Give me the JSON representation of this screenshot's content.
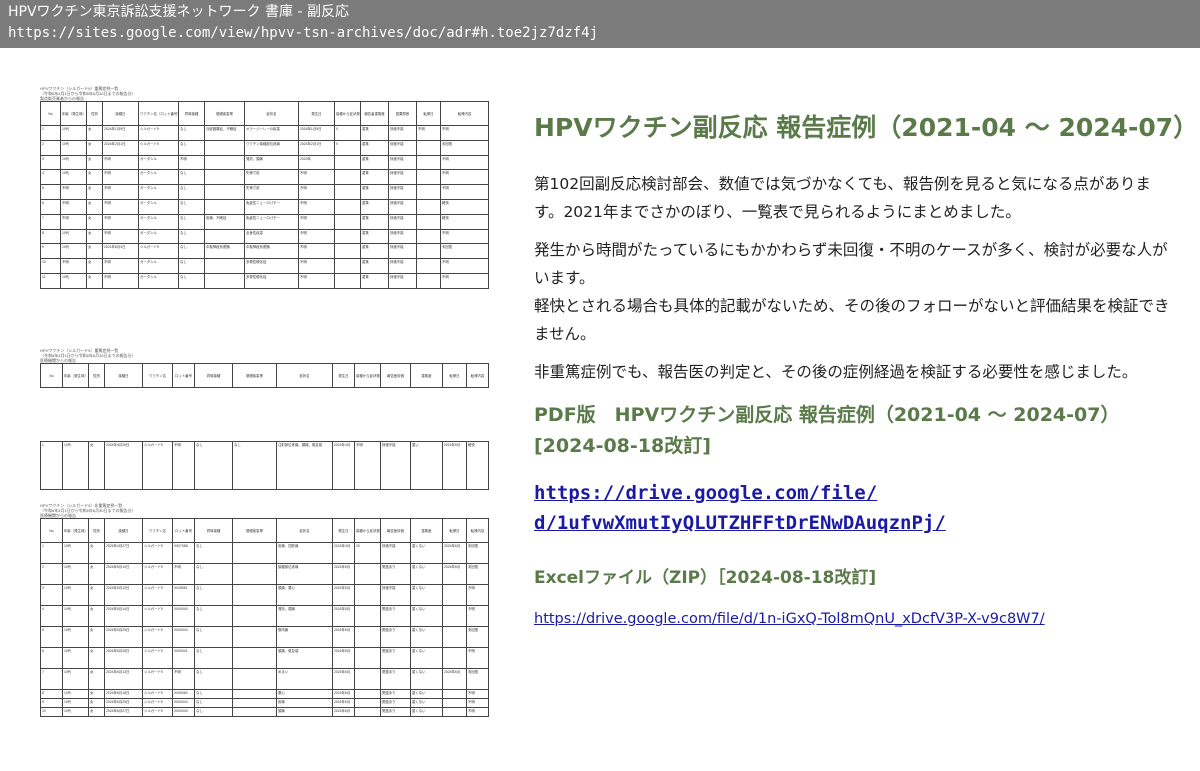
{
  "window": {
    "title": "HPVワクチン東京訴訟支援ネットワーク 書庫 - 副反応",
    "url": "https://sites.google.com/view/hpvv-tsn-archives/doc/adr#h.toe2jz7dzf4j"
  },
  "main": {
    "heading": "HPVワクチン副反応 報告症例（2021-04 〜 2024-07）",
    "paragraphs": [
      "第102回副反応検討部会、数値では気づかなくても、報告例を見ると気になる点があります。2021年までさかのぼり、一覧表で見られるようにまとめました。",
      "発生から時間がたっているにもかかわらず未回復・不明のケースが多く、検討が必要な人がいます。",
      "軽快とされる場合も具体的記載がないため、その後のフォローがないと評価結果を検証できません。",
      "非重篤症例でも、報告医の判定と、その後の症例経過を検証する必要性を感じました。"
    ],
    "pdf_title": "PDF版　HPVワクチン副反応 報告症例（2021-04 〜 2024-07）",
    "pdf_revision": "[2024-08-18改訂]",
    "pdf_link_line1": "https://drive.google.com/file/",
    "pdf_link_line2": "d/1ufvwXmutIyQLUTZHFFtDrENwDAuqznPj/",
    "excel_title": "Excelファイル（ZIP）［2024-08-18改訂]",
    "excel_link": "https://drive.google.com/file/d/1n-iGxQ-Tol8mQnU_xDcfV3P-X-v9c8W7/"
  },
  "scan": {
    "page1": {
      "caption1": "HPVワクチン（シルガード9）重篤症例一覧",
      "caption2": "（令和6年4月1日から令和6年6月30日までの報告分）",
      "caption3": "製造販売業者からの報告",
      "headers": [
        "No",
        "年齢（発生時）",
        "性別",
        "接種日",
        "ワクチン名（ロット番号）",
        "同時接種",
        "基礎疾患等",
        "症状名",
        "発生日",
        "接種から症状発生までの日数",
        "報告者重篤度",
        "因果関係",
        "転帰日",
        "転帰内容"
      ],
      "rows": [
        [
          "1",
          "10代",
          "女",
          "2024年1月9日",
          "シルガード9",
          "なし",
          "月経困難症、不眠症",
          "オラージーレーの疾患",
          "2024年1月9日",
          "0",
          "重篤",
          "評価不能",
          "不明",
          "不明"
        ],
        [
          "2",
          "10代",
          "女",
          "2024年2月1日",
          "シルガード9",
          "なし",
          "",
          "ワクチン接種部位疼痛",
          "2024年2月1日",
          "0",
          "重篤",
          "評価不能",
          "",
          "未回復"
        ],
        [
          "3",
          "10代",
          "女",
          "不明",
          "ガーダシル",
          "不明",
          "",
          "発熱、頭痛",
          "2023年",
          "",
          "重篤",
          "評価不能",
          "",
          "不明"
        ],
        [
          "4",
          "10代",
          "女",
          "不明",
          "ガーダシル",
          "なし",
          "",
          "失神寸前",
          "不明",
          "",
          "重篤",
          "評価不能",
          "",
          "不明"
        ],
        [
          "5",
          "不明",
          "女",
          "不明",
          "ガーダシル",
          "なし",
          "",
          "失神寸前",
          "不明",
          "",
          "重篤",
          "評価不能",
          "",
          "不明"
        ],
        [
          "6",
          "不明",
          "女",
          "不明",
          "ガーダシル",
          "なし",
          "",
          "免疫性ニューロパチー",
          "不明",
          "",
          "重篤",
          "評価不能",
          "",
          "軽快"
        ],
        [
          "7",
          "不明",
          "女",
          "不明",
          "ガーダシル",
          "なし",
          "疼痛、不眠症",
          "免疫性ニューロパチー",
          "不明",
          "",
          "重篤",
          "評価不能",
          "",
          "軽快"
        ],
        [
          "8",
          "10代",
          "女",
          "不明",
          "ガーダシル",
          "なし",
          "",
          "全身性疾患",
          "不明",
          "",
          "重篤",
          "評価不能",
          "",
          "不明"
        ],
        [
          "9",
          "10代",
          "女",
          "2021年8月3日",
          "シルガード9",
          "なし",
          "中枢神経系脱髄",
          "中枢神経系脱髄",
          "不明",
          "",
          "重篤",
          "評価不能",
          "",
          "未回復"
        ],
        [
          "10",
          "不明",
          "女",
          "不明",
          "ガーダシル",
          "なし",
          "",
          "多発性硬化症",
          "不明",
          "",
          "重篤",
          "評価不能",
          "",
          "不明"
        ],
        [
          "11",
          "10代",
          "女",
          "不明",
          "ガーダシル",
          "なし",
          "",
          "多発性硬化症",
          "不明",
          "",
          "重篤",
          "評価不能",
          "",
          "不明"
        ]
      ]
    },
    "page2": {
      "caption1": "HPVワクチン（シルガード9）重篤症例一覧",
      "caption2": "（令和6年4月1日から令和6年6月30日までの報告分）",
      "caption3": "医療機関からの報告",
      "headers": [
        "No",
        "年齢（発生時）",
        "性別",
        "接種日",
        "ワクチン名",
        "ロット番号",
        "同時接種",
        "基礎疾患等",
        "症状名",
        "発生日",
        "接種から症状発生までの日数",
        "報告医評価",
        "重篤度",
        "転帰日",
        "転帰内容"
      ],
      "row": [
        "1",
        "10代",
        "女",
        "2024年4月26日",
        "シルガード9",
        "不明",
        "なし",
        "なし",
        "注射部位疼痛、頭痛、倦怠感",
        "2024年4月",
        "不明",
        "評価不能",
        "重い",
        "2024年5月",
        "軽快"
      ]
    },
    "page3": {
      "caption1": "HPVワクチン（シルガード9）非重篤症例一覧",
      "caption2": "（令和6年4月1日から令和6年6月30日までの報告分）",
      "caption3": "医療機関からの報告",
      "headers": [
        "No",
        "年齢（発生時）",
        "性別",
        "接種日",
        "ワクチン名",
        "ロット番号",
        "同時接種",
        "基礎疾患等",
        "症状名",
        "発生日",
        "接種から症状発生までの日数",
        "報告医評価",
        "重篤度",
        "転帰日",
        "転帰内容"
      ],
      "rows": [
        [
          "1",
          "10代",
          "女",
          "2024年4月27日",
          "シルガード9",
          "X007088",
          "なし",
          "",
          "疼痛、四肢痛",
          "2024年4月",
          "20",
          "評価不能",
          "重くない",
          "2024年6月",
          "未回復"
        ],
        [
          "2",
          "10代",
          "女",
          "2024年5月10日",
          "シルガード9",
          "不明",
          "なし",
          "",
          "接種部位疼痛",
          "2024年5月",
          "",
          "関連あり",
          "重くない",
          "2024年5月",
          "未回復"
        ],
        [
          "3",
          "10代",
          "女",
          "2024年5月13日",
          "シルガード9",
          "X028981",
          "なし",
          "",
          "頭痛、悪心",
          "2024年5月",
          "",
          "評価不能",
          "重くない",
          "",
          "不明"
        ],
        [
          "4",
          "10代",
          "女",
          "2024年5月14日",
          "シルガード9",
          "X000040",
          "なし",
          "",
          "発熱、頭痛",
          "2024年5月",
          "",
          "関連あり",
          "重くない",
          "",
          "不明"
        ],
        [
          "5",
          "10代",
          "女",
          "2024年5月25日",
          "シルガード9",
          "X000040",
          "なし",
          "",
          "筋肉痛",
          "2024年5月",
          "",
          "関連あり",
          "重くない",
          "",
          "未回復"
        ],
        [
          "6",
          "10代",
          "女",
          "2024年5月28日",
          "シルガード9",
          "X000041",
          "なし",
          "",
          "頭痛、倦怠感",
          "2024年5月",
          "",
          "関連あり",
          "重くない",
          "",
          "不明"
        ],
        [
          "7",
          "10代",
          "女",
          "2024年6月13日",
          "シルガード9",
          "不明",
          "なし",
          "",
          "めまい",
          "2024年6月",
          "",
          "関連あり",
          "重くない",
          "2024年6月",
          "未回復"
        ],
        [
          "8",
          "10代",
          "女",
          "2024年6月18日",
          "シルガード9",
          "X006060",
          "なし",
          "",
          "悪心",
          "2024年6月",
          "",
          "関連あり",
          "重くない",
          "",
          "不明"
        ],
        [
          "9",
          "10代",
          "女",
          "2024年6月25日",
          "シルガード9",
          "X000040",
          "なし",
          "",
          "疼痛",
          "2024年6月",
          "",
          "関連あり",
          "重くない",
          "",
          "不明"
        ],
        [
          "10",
          "10代",
          "女",
          "2024年6月27日",
          "シルガード9",
          "X000040",
          "なし",
          "",
          "頭痛",
          "2024年6月",
          "",
          "関連あり",
          "重くない",
          "",
          "不明"
        ]
      ]
    }
  }
}
